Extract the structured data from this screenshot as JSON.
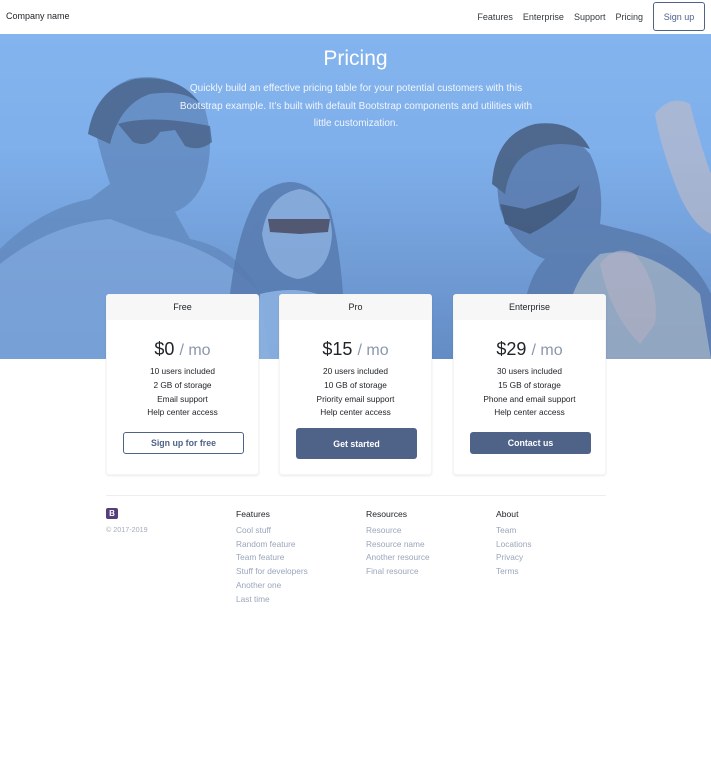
{
  "navbar": {
    "brand": "Company name",
    "links": [
      "Features",
      "Enterprise",
      "Support",
      "Pricing"
    ],
    "signup_label": "Sign up"
  },
  "hero": {
    "title": "Pricing",
    "lead": "Quickly build an effective pricing table for your potential customers with this Bootstrap example. It’s built with default Bootstrap components and utilities with little customization."
  },
  "plans": [
    {
      "name": "Free",
      "price": "$0",
      "period": "/ mo",
      "features": [
        "10 users included",
        "2 GB of storage",
        "Email support",
        "Help center access"
      ],
      "button_label": "Sign up for free"
    },
    {
      "name": "Pro",
      "price": "$15",
      "period": "/ mo",
      "features": [
        "20 users included",
        "10 GB of storage",
        "Priority email support",
        "Help center access"
      ],
      "button_label": "Get started"
    },
    {
      "name": "Enterprise",
      "price": "$29",
      "period": "/ mo",
      "features": [
        "30 users included",
        "15 GB of storage",
        "Phone and email support",
        "Help center access"
      ],
      "button_label": "Contact us"
    }
  ],
  "footer": {
    "logo_letter": "B",
    "copyright": "© 2017-2019",
    "columns": [
      {
        "title": "Features",
        "links": [
          "Cool stuff",
          "Random feature",
          "Team feature",
          "Stuff for developers",
          "Another one",
          "Last time"
        ]
      },
      {
        "title": "Resources",
        "links": [
          "Resource",
          "Resource name",
          "Another resource",
          "Final resource"
        ]
      },
      {
        "title": "About",
        "links": [
          "Team",
          "Locations",
          "Privacy",
          "Terms"
        ]
      }
    ]
  },
  "colors": {
    "accent": "#4f6389",
    "hero_sky": "#86b6ef",
    "muted_link": "#9aa6bb",
    "bootstrap_purple": "#563d7c"
  }
}
